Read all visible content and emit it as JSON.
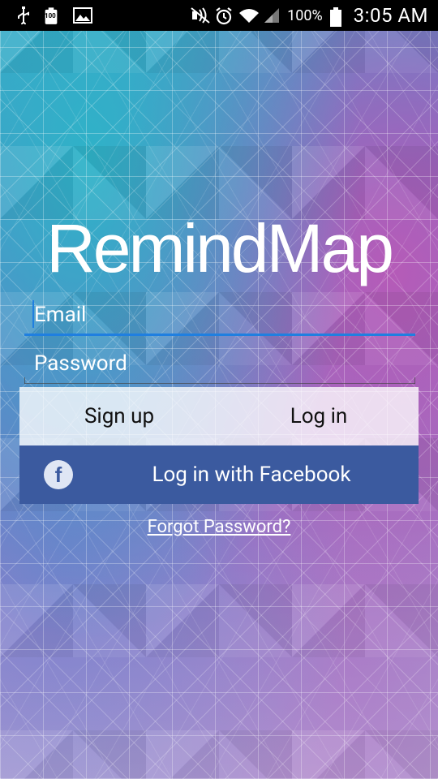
{
  "status_bar": {
    "battery_small_label": "100",
    "battery_percent": "100%",
    "time": "3:05 AM",
    "icons_left": [
      "usb-icon",
      "battery-100-icon",
      "image-icon"
    ],
    "icons_right": [
      "nfc-muted-icon",
      "alarm-icon",
      "wifi-icon",
      "signal-icon",
      "battery-icon"
    ]
  },
  "app": {
    "logo_text": "RemindMap"
  },
  "form": {
    "email_placeholder": "Email",
    "password_placeholder": "Password"
  },
  "buttons": {
    "sign_up": "Sign up",
    "log_in": "Log in",
    "facebook": "Log in with Facebook",
    "forgot_password": "Forgot Password?"
  },
  "colors": {
    "facebook": "#3b5a9f",
    "accent": "#1f7fe0"
  }
}
